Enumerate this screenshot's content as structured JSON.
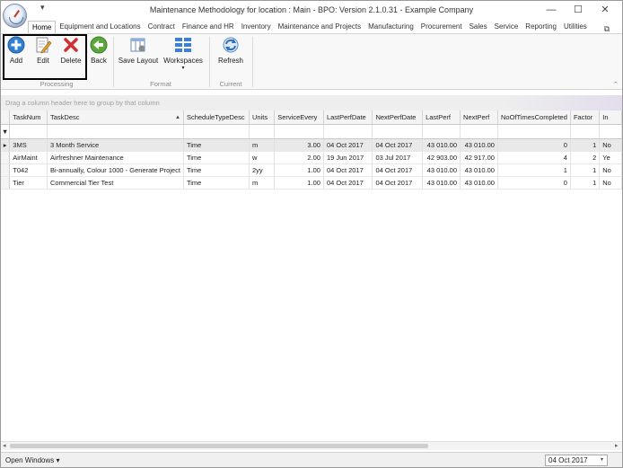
{
  "window": {
    "title": "Maintenance Methodology for location : Main - BPO: Version 2.1.0.31 - Example Company",
    "qat_glyph": "▾",
    "minimize": "—",
    "maximize": "☐",
    "close": "✕",
    "restore": "⧉"
  },
  "tabs": [
    "Home",
    "Equipment and Locations",
    "Contract",
    "Finance and HR",
    "Inventory",
    "Maintenance and Projects",
    "Manufacturing",
    "Procurement",
    "Sales",
    "Service",
    "Reporting",
    "Utilities"
  ],
  "ribbon": {
    "add": "Add",
    "edit": "Edit",
    "delete": "Delete",
    "back": "Back",
    "save_layout": "Save Layout",
    "workspaces": "Workspaces",
    "workspaces_drop": "▾",
    "refresh": "Refresh",
    "group_processing": "Processing",
    "group_format": "Format",
    "group_current": "Current",
    "collapse": "⌃"
  },
  "group_panel": "Drag a column header here to group by that column",
  "grid": {
    "columns": [
      "TaskNum",
      "TaskDesc",
      "ScheduleTypeDesc",
      "Units",
      "ServiceEvery",
      "LastPerfDate",
      "NextPerfDate",
      "LastPerf",
      "NextPerf",
      "NoOfTimesCompleted",
      "Factor",
      "In"
    ],
    "sort_glyph": "▲",
    "filter_glyph": "▼",
    "row_pointer": "▸",
    "rows": [
      [
        "3MS",
        "3 Month Service",
        "Time",
        "m",
        "3.00",
        "04 Oct 2017",
        "04 Oct 2017",
        "43 010.00",
        "43 010.00",
        "0",
        "1",
        "No"
      ],
      [
        "AirMaint",
        "Airfreshner Maintenance",
        "Time",
        "w",
        "2.00",
        "19 Jun 2017",
        "03 Jul 2017",
        "42 903.00",
        "42 917.00",
        "4",
        "2",
        "Ye"
      ],
      [
        "T042",
        "Bi-annually, Colour 1000 - Generate Project",
        "Time",
        "2yy",
        "1.00",
        "04 Oct 2017",
        "04 Oct 2017",
        "43 010.00",
        "43 010.00",
        "1",
        "1",
        "No"
      ],
      [
        "Tier",
        "Commercial Tier Test",
        "Time",
        "m",
        "1.00",
        "04 Oct 2017",
        "04 Oct 2017",
        "43 010.00",
        "43 010.00",
        "0",
        "1",
        "No"
      ]
    ]
  },
  "scroll": {
    "left": "◂",
    "right": "▸"
  },
  "status": {
    "open_windows": "Open Windows ▾",
    "date": "04 Oct 2017",
    "date_drop": "▾"
  }
}
